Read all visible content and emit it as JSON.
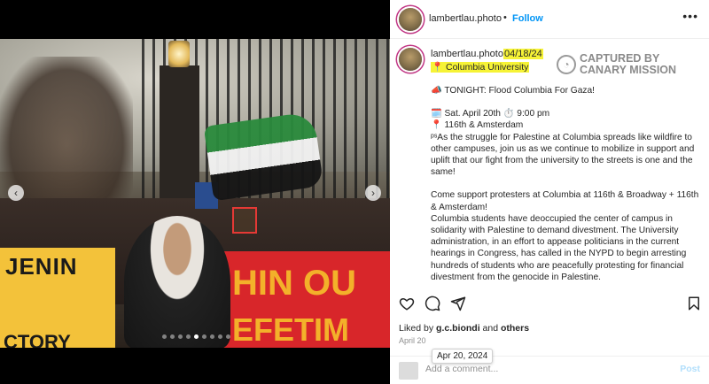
{
  "post": {
    "username": "lambertlau.photo",
    "follow_label": "Follow",
    "caption_username": "lambertlau.photo",
    "date_highlight": "04/18/24",
    "location": "Columbia University",
    "watermark": "CAPTURED BY CANARY MISSION",
    "caption_lines": [
      "📣 TONIGHT: Flood Columbia For Gaza!",
      "",
      "🗓️ Sat. April 20th  ⏱️ 9:00 pm",
      "📍 116th & Amsterdam",
      "ᵖˢAs the struggle for Palestine at Columbia spreads like wildfire to other campuses, join us as we continue to mobilize in support and uplift that our fight from the university to the streets is one and the same!",
      "",
      "Come support protesters at Columbia at 116th & Broadway + 116th & Amsterdam!",
      "Columbia students have deoccupied the center of campus in solidarity with Palestine to demand divestment. The University administration, in an effort to appease politicians in the current hearings in Congress, has called in the NYPD to begin arresting hundreds of students who are peacefully protesting for financial divestment from the genocide in Palestine."
    ],
    "liked_by_prefix": "Liked by ",
    "liked_by_user": "g.c.biondi",
    "liked_by_and": " and ",
    "liked_by_others": "others",
    "date_label": "April 20",
    "tooltip_date": "Apr 20, 2024",
    "comment_placeholder": "Add a comment...",
    "post_button": "Post"
  },
  "photo": {
    "banner_left_text": "JENIN",
    "banner_left_text2": "CTORY",
    "banner_right_text": "HIN OU",
    "banner_right_text2": "EFETIM"
  },
  "carousel": {
    "dot_count": 9,
    "active_index": 4
  },
  "icons": {
    "heart": "heart-icon",
    "comment": "comment-icon",
    "share": "share-icon",
    "save": "bookmark-icon",
    "more": "more-icon",
    "location_pin": "pin-icon"
  },
  "colors": {
    "follow": "#0095f6",
    "highlight": "#f6f336",
    "post_button": "#b2dffc"
  }
}
